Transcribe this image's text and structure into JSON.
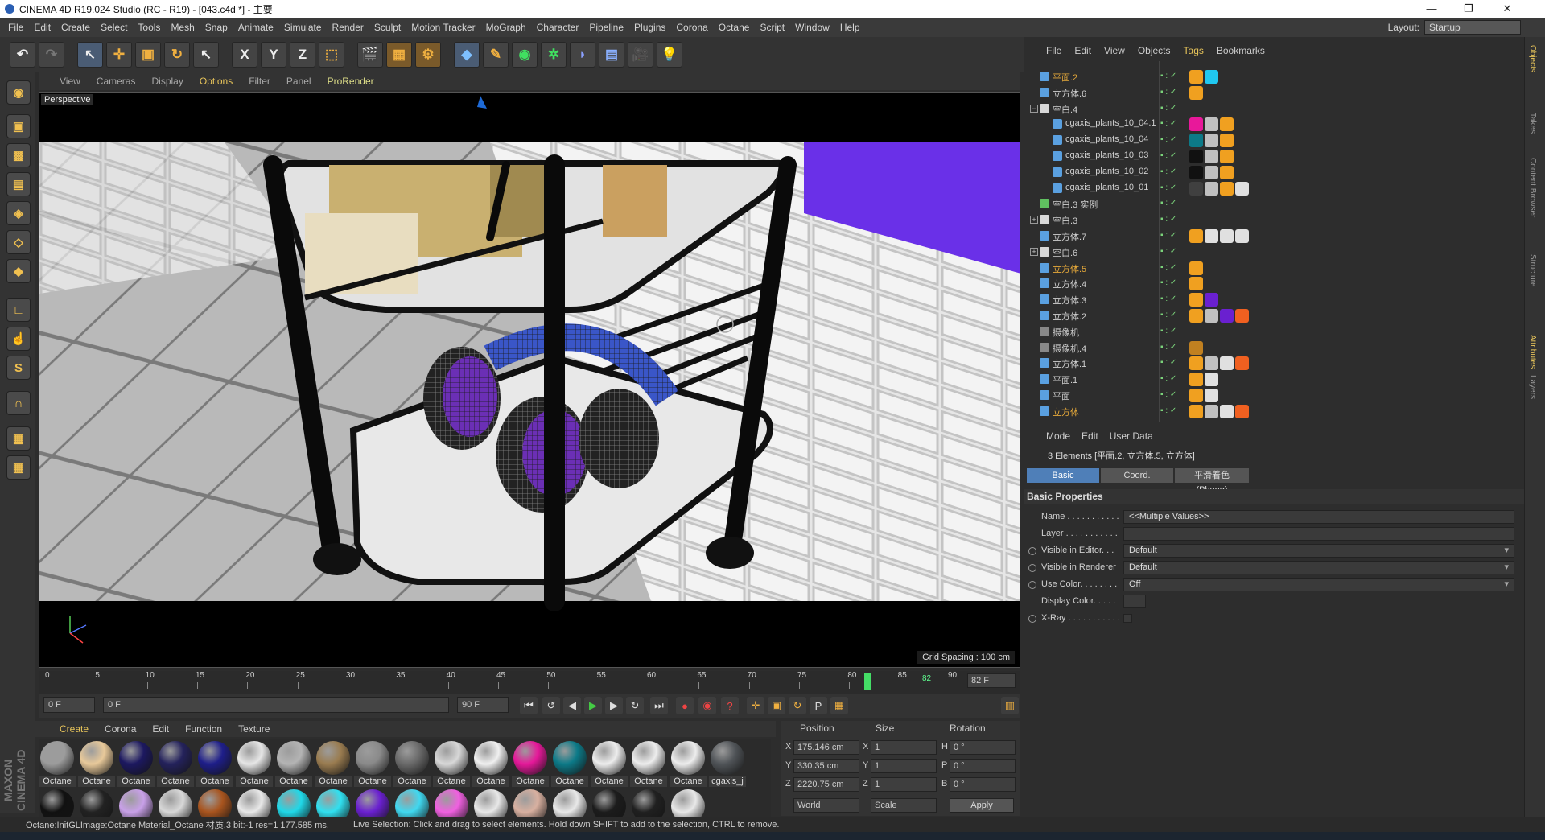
{
  "window": {
    "title": "CINEMA 4D R19.024 Studio (RC - R19) - [043.c4d *] - 主要",
    "min": "—",
    "max": "❐",
    "close": "✕"
  },
  "menu": [
    "File",
    "Edit",
    "Create",
    "Select",
    "Tools",
    "Mesh",
    "Snap",
    "Animate",
    "Simulate",
    "Render",
    "Sculpt",
    "Motion Tracker",
    "MoGraph",
    "Character",
    "Pipeline",
    "Plugins",
    "Corona",
    "Octane",
    "Script",
    "Window",
    "Help"
  ],
  "layout": {
    "label": "Layout:",
    "value": "Startup"
  },
  "toolbar": {
    "icons": [
      "undo-icon",
      "redo-icon",
      "live-selection-icon",
      "move-icon",
      "scale-icon",
      "rotate-icon",
      "last-tool-icon",
      "x-axis-icon",
      "y-axis-icon",
      "z-axis-icon",
      "world-coordinates-icon",
      "render-view-icon",
      "render-picture-viewer-icon",
      "edit-render-settings-icon",
      "cube-icon",
      "pen-icon",
      "subdivision-icon",
      "cloner-icon",
      "deformer-icon",
      "floor-icon",
      "camera-icon",
      "light-icon"
    ],
    "x": "X",
    "y": "Y",
    "z": "Z"
  },
  "viewport": {
    "menu": [
      "View",
      "Cameras",
      "Display",
      "Options",
      "Filter",
      "Panel",
      "ProRender"
    ],
    "active_menu": "Options",
    "label": "Perspective",
    "grid_spacing": "Grid Spacing : 100 cm"
  },
  "timeline": {
    "ticks": [
      "0",
      "5",
      "10",
      "15",
      "20",
      "25",
      "30",
      "35",
      "40",
      "45",
      "50",
      "55",
      "60",
      "65",
      "70",
      "75",
      "80",
      "85",
      "90"
    ],
    "current": "82",
    "end_field": "82 F",
    "start_field": "0 F",
    "range_start": "0 F",
    "range_end": "90 F",
    "max_field": "90 F",
    "current_fraction": 0.911
  },
  "material_manager": {
    "menu": [
      "Create",
      "Corona",
      "Edit",
      "Function",
      "Texture"
    ],
    "materials": [
      {
        "label": "Octane",
        "color": "#9c9c9c"
      },
      {
        "label": "Octane",
        "color": "#e8c99a"
      },
      {
        "label": "Octane",
        "color": "#1c1860"
      },
      {
        "label": "Octane",
        "color": "#24225c"
      },
      {
        "label": "Octane",
        "color": "#1e1e8a"
      },
      {
        "label": "Octane",
        "color": "#e6e6e6"
      },
      {
        "label": "Octane",
        "color": "#b4b4b4"
      },
      {
        "label": "Octane",
        "color": "#9a7c50"
      },
      {
        "label": "Octane",
        "color": "#8a8a8a"
      },
      {
        "label": "Octane",
        "color": "#6a6a6a"
      },
      {
        "label": "Octane",
        "color": "#d8d8d8"
      },
      {
        "label": "Octane",
        "color": "#f0f0f0"
      },
      {
        "label": "Octane",
        "color": "#e6189a"
      },
      {
        "label": "Octane",
        "color": "#0c7a88"
      },
      {
        "label": "Octane",
        "color": "#ededed"
      },
      {
        "label": "Octane",
        "color": "#ededed"
      },
      {
        "label": "Octane",
        "color": "#ededed"
      },
      {
        "label": "cgaxis_j",
        "color": "#505458"
      }
    ],
    "row2_colors": [
      "#111111",
      "#222222",
      "#c8a0e8",
      "#d8d8d8",
      "#a8541e",
      "#e8e8e8",
      "#20d8e8",
      "#30e0f0",
      "#6a20d0",
      "#40d8f0",
      "#f060e0",
      "#e8e8e8",
      "#d8b0a0",
      "#e8e8e8",
      "#1c1c1c",
      "#202020",
      "#e8e8e8"
    ]
  },
  "coordinates": {
    "headers": {
      "position": "Position",
      "size": "Size",
      "rotation": "Rotation"
    },
    "rows": [
      {
        "axis": "X",
        "pos": "175.146 cm",
        "saxis": "X",
        "size": "1",
        "raxis": "H",
        "rot": "0 °"
      },
      {
        "axis": "Y",
        "pos": "330.35 cm",
        "saxis": "Y",
        "size": "1",
        "raxis": "P",
        "rot": "0 °"
      },
      {
        "axis": "Z",
        "pos": "2220.75 cm",
        "saxis": "Z",
        "size": "1",
        "raxis": "B",
        "rot": "0 °"
      }
    ],
    "world": "World",
    "scale": "Scale",
    "apply": "Apply"
  },
  "object_manager": {
    "menu": [
      "File",
      "Edit",
      "View",
      "Objects",
      "Tags",
      "Bookmarks"
    ],
    "active_menu": "Tags",
    "objects": [
      {
        "name": "平面.2",
        "indent": 1,
        "icon": "#5aa0e0",
        "selected": true,
        "tags": [
          "#f0a020",
          "#20c8f0"
        ]
      },
      {
        "name": "立方体.6",
        "indent": 1,
        "icon": "#5aa0e0",
        "selected": false,
        "tags": [
          "#f0a020"
        ]
      },
      {
        "name": "空白.4",
        "indent": 1,
        "icon": "#d8d8d8",
        "expand": "−",
        "selected": false,
        "tags": []
      },
      {
        "name": "cgaxis_plants_10_04.1",
        "indent": 2,
        "icon": "#5aa0e0",
        "selected": false,
        "tags": [
          "#e8189a",
          "#c0c0c0",
          "#f0a020"
        ]
      },
      {
        "name": "cgaxis_plants_10_04",
        "indent": 2,
        "icon": "#5aa0e0",
        "selected": false,
        "tags": [
          "#0c7a88",
          "#c0c0c0",
          "#f0a020"
        ]
      },
      {
        "name": "cgaxis_plants_10_03",
        "indent": 2,
        "icon": "#5aa0e0",
        "selected": false,
        "tags": [
          "#111111",
          "#c0c0c0",
          "#f0a020"
        ]
      },
      {
        "name": "cgaxis_plants_10_02",
        "indent": 2,
        "icon": "#5aa0e0",
        "selected": false,
        "tags": [
          "#111111",
          "#c0c0c0",
          "#f0a020"
        ]
      },
      {
        "name": "cgaxis_plants_10_01",
        "indent": 2,
        "icon": "#5aa0e0",
        "selected": false,
        "tags": [
          "#404040",
          "#c0c0c0",
          "#f0a020",
          "#e0e0e0"
        ]
      },
      {
        "name": "空白.3 实例",
        "indent": 1,
        "icon": "#60c060",
        "selected": false,
        "tags": []
      },
      {
        "name": "空白.3",
        "indent": 1,
        "icon": "#d8d8d8",
        "expand": "+",
        "selected": false,
        "tags": []
      },
      {
        "name": "立方体.7",
        "indent": 1,
        "icon": "#5aa0e0",
        "selected": false,
        "tags": [
          "#f0a020",
          "#e0e0e0",
          "#e0e0e0",
          "#e0e0e0"
        ]
      },
      {
        "name": "空白.6",
        "indent": 1,
        "icon": "#d8d8d8",
        "expand": "+",
        "selected": false,
        "tags": []
      },
      {
        "name": "立方体.5",
        "indent": 1,
        "icon": "#5aa0e0",
        "selected": true,
        "tags": [
          "#f0a020"
        ]
      },
      {
        "name": "立方体.4",
        "indent": 1,
        "icon": "#5aa0e0",
        "selected": false,
        "tags": [
          "#f0a020"
        ]
      },
      {
        "name": "立方体.3",
        "indent": 1,
        "icon": "#5aa0e0",
        "selected": false,
        "tags": [
          "#f0a020",
          "#6a20d0"
        ]
      },
      {
        "name": "立方体.2",
        "indent": 1,
        "icon": "#5aa0e0",
        "selected": false,
        "tags": [
          "#f0a020",
          "#c0c0c0",
          "#6a20d0",
          "#f06020"
        ]
      },
      {
        "name": "摄像机",
        "indent": 1,
        "icon": "#888888",
        "selected": false,
        "tags": []
      },
      {
        "name": "摄像机.4",
        "indent": 1,
        "icon": "#888888",
        "selected": false,
        "tags": [
          "#c08020"
        ]
      },
      {
        "name": "立方体.1",
        "indent": 1,
        "icon": "#5aa0e0",
        "selected": false,
        "tags": [
          "#f0a020",
          "#c0c0c0",
          "#e0e0e0",
          "#f06020"
        ]
      },
      {
        "name": "平面.1",
        "indent": 1,
        "icon": "#5aa0e0",
        "selected": false,
        "tags": [
          "#f0a020",
          "#e0e0e0"
        ]
      },
      {
        "name": "平面",
        "indent": 1,
        "icon": "#5aa0e0",
        "selected": false,
        "tags": [
          "#f0a020",
          "#e0e0e0"
        ]
      },
      {
        "name": "立方体",
        "indent": 1,
        "icon": "#5aa0e0",
        "selected": true,
        "tags": [
          "#f0a020",
          "#c0c0c0",
          "#e0e0e0",
          "#f06020"
        ]
      }
    ]
  },
  "attributes": {
    "menu": [
      "Mode",
      "Edit",
      "User Data"
    ],
    "title": "3 Elements [平面.2, 立方体.5, 立方体]",
    "tabs": [
      "Basic",
      "Coord.",
      "平滑着色(Phong)"
    ],
    "section": "Basic Properties",
    "props": [
      {
        "label": "Name . . . . . . . . . . .",
        "value": "<<Multiple Values>>",
        "radio": false
      },
      {
        "label": "Layer . . . . . . . . . . .",
        "value": "",
        "radio": false
      },
      {
        "label": "Visible in Editor. . .",
        "value": "Default",
        "radio": true,
        "dd": true
      },
      {
        "label": "Visible in Renderer",
        "value": "Default",
        "radio": true,
        "dd": true
      },
      {
        "label": "Use Color. . . . . . . .",
        "value": "Off",
        "radio": true,
        "dd": true
      },
      {
        "label": "Display Color. . . . .",
        "value": "",
        "radio": false
      },
      {
        "label": "X-Ray . . . . . . . . . . .",
        "value": "",
        "radio": true
      }
    ]
  },
  "right_tabs": [
    "Objects",
    "Takes",
    "Content Browser",
    "Structure",
    "Attributes",
    "Layers"
  ],
  "status": {
    "left": "Octane:InitGLImage:Octane Material_Octane 材质.3  bit:-1 res=1  177.585 ms.",
    "right": "Live Selection: Click and drag to select elements. Hold down SHIFT to add to the selection, CTRL to remove."
  },
  "brand": "MAXON CINEMA 4D"
}
